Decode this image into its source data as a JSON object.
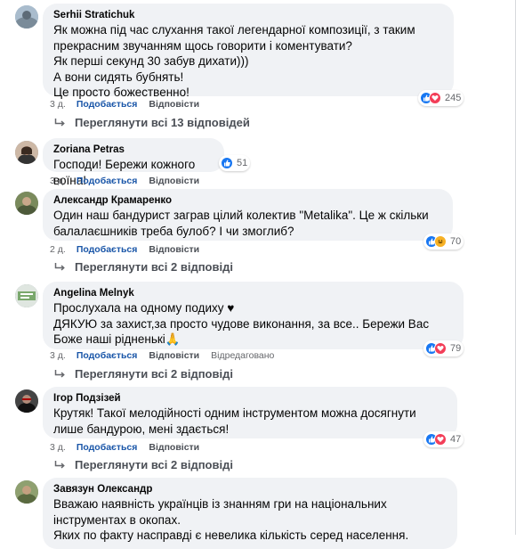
{
  "colors": {
    "like": "#1877f2",
    "love": "#f33e58",
    "haha": "#f7b125",
    "bubble": "#f0f2f5",
    "link": "#1a56a8"
  },
  "comments": [
    {
      "author": "Serhii Stratichuk",
      "text": "Як можна під час слухання такої легендарної композиції, з таким прекрасним звучанням щось говорити і коментувати?\nЯк перші секунд 30 забув дихати)))\nА вони сидять бубнять!\nЦе просто божественно!",
      "reactions": [
        "like-icon",
        "love-icon"
      ],
      "reaction_count": "245",
      "time": "3 д.",
      "like_label": "Подобається",
      "reply_label": "Відповісти",
      "replies_label": "Переглянути всі 13 відповідей"
    },
    {
      "author": "Zoriana Petras",
      "text": "Господи! Бережи кожного воїна!",
      "reactions": [
        "like-icon"
      ],
      "reaction_count": "51",
      "time": "3 д.",
      "like_label": "Подобається",
      "reply_label": "Відповісти"
    },
    {
      "author": "Александр Крамаренко",
      "text": "Один наш бандурист заграв цілий колектив \"Metalika\". Це ж скільки балалаєшників треба булоб? І чи змоглиб?",
      "reactions": [
        "like-icon",
        "haha-icon"
      ],
      "reaction_count": "70",
      "time": "2 д.",
      "like_label": "Подобається",
      "reply_label": "Відповісти",
      "replies_label": "Переглянути всі 2 відповіді"
    },
    {
      "author": "Angelina Melnyk",
      "text": "Прослухала на одному подиху ♥\nДЯКУЮ за захист,за просто чудове виконання, за все.. Бережи Вас Боже наші рідненькі🙏",
      "reactions": [
        "like-icon",
        "love-icon"
      ],
      "reaction_count": "79",
      "time": "3 д.",
      "like_label": "Подобається",
      "reply_label": "Відповісти",
      "edited_label": "Відредаговано",
      "replies_label": "Переглянути всі 2 відповіді"
    },
    {
      "author": "Ігор Подзізей",
      "text": "Крутяк! Такої мелодійності одним інструментом можна досягнути лише бандурою, мені здається!",
      "reactions": [
        "like-icon",
        "love-icon"
      ],
      "reaction_count": "47",
      "time": "3 д.",
      "like_label": "Подобається",
      "reply_label": "Відповісти",
      "replies_label": "Переглянути всі 2 відповіді"
    },
    {
      "author": "Завязун Олександр",
      "text": "Вважаю наявність українців із знанням гри на національних інструментах в окопах.\nЯких по факту насправді є невелика кількість серед населення."
    }
  ]
}
